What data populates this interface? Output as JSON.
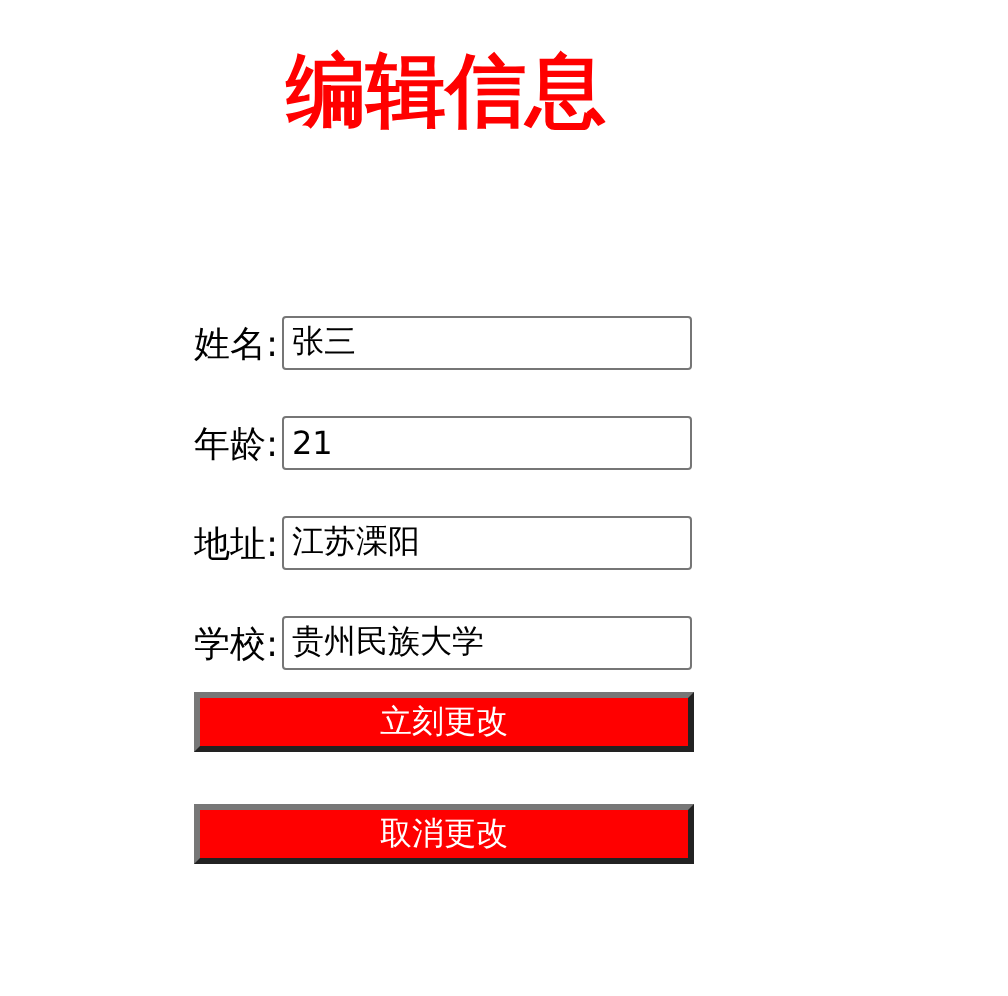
{
  "title": "编辑信息",
  "fields": [
    {
      "label": "姓名:",
      "value": "张三"
    },
    {
      "label": "年龄:",
      "value": "21"
    },
    {
      "label": "地址:",
      "value": "江苏溧阳"
    },
    {
      "label": "学校:",
      "value": "贵州民族大学"
    }
  ],
  "buttons": [
    "立刻更改",
    "取消更改"
  ]
}
